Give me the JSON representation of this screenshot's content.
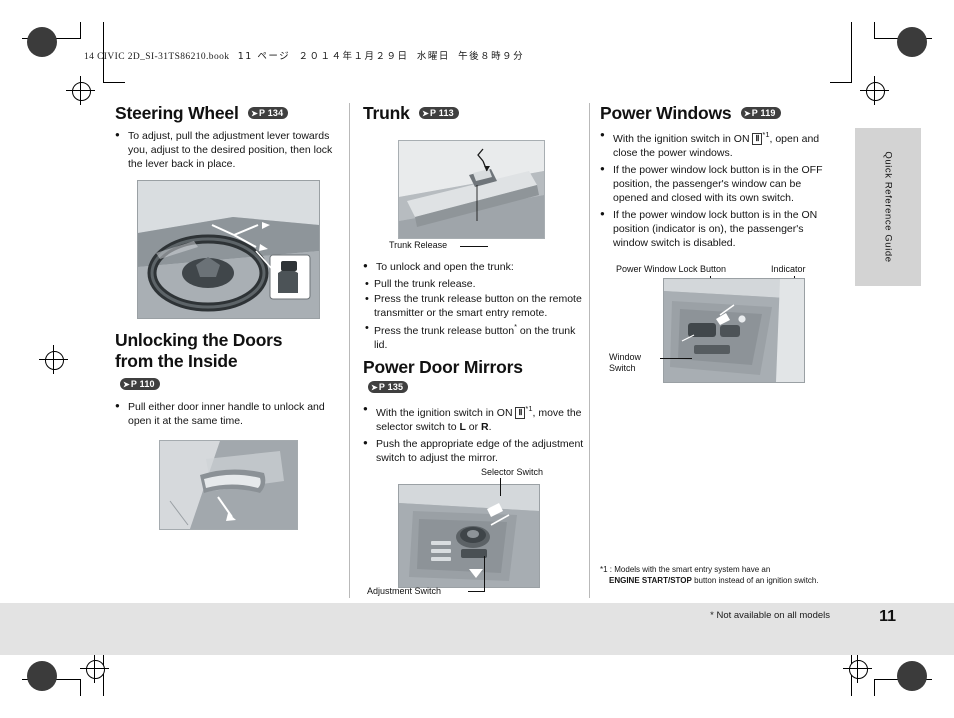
{
  "document": {
    "slug_code": "14 CIVIC 2D_SI-31TS86210.book",
    "slug_page": "11 ページ",
    "slug_date": "２０１４年１月２９日",
    "slug_day": "水曜日",
    "slug_time": "午後８時９分",
    "page_number": "11",
    "side_tab": "Quick Reference Guide",
    "bottom_note": "* Not available on all models"
  },
  "columns": {
    "left": {
      "section1": {
        "title": "Steering Wheel",
        "page_ref": "P 134",
        "bullets": [
          "To adjust, pull the adjustment lever towards you, adjust to the desired position, then lock the lever back in place."
        ]
      },
      "section2": {
        "title_line1": "Unlocking the Doors",
        "title_line2": "from the Inside",
        "page_ref": "P 110",
        "bullets": [
          "Pull either door inner handle to unlock and open it at the same time."
        ]
      }
    },
    "middle": {
      "section1": {
        "title": "Trunk",
        "page_ref": "P 113",
        "figure_label": "Trunk Release",
        "bullets": [
          "To unlock and open the trunk:"
        ],
        "sub_bullets": [
          "Pull the trunk release.",
          "Press the trunk release button on the remote transmitter or the smart entry remote.",
          "Press the trunk release button* on the trunk lid."
        ]
      },
      "section2": {
        "title": "Power Door Mirrors",
        "page_ref": "P 135",
        "bullets": [
          "With the ignition switch in ON Ⅱ*1, move the selector switch to L or R.",
          "Push the appropriate edge of the adjustment switch to adjust the mirror."
        ],
        "figure_labels": {
          "selector": "Selector Switch",
          "adjustment": "Adjustment Switch"
        }
      }
    },
    "right": {
      "section1": {
        "title": "Power Windows",
        "page_ref": "P 119",
        "bullets": [
          "With the ignition switch in ON Ⅱ*1, open and close the power windows.",
          "If the power window lock button is in the OFF position, the passenger's window can be opened and closed with its own switch.",
          "If the power window lock button is in the ON position (indicator is on), the passenger's window switch is disabled."
        ],
        "figure_labels": {
          "lock_button": "Power Window Lock Button",
          "indicator": "Indicator",
          "window_switch_line1": "Window",
          "window_switch_line2": "Switch"
        }
      },
      "footnote": {
        "marker": "*1 :",
        "text_before": "Models with the smart entry system have an",
        "bold": "ENGINE START/STOP",
        "text_after": "button instead of an ignition switch."
      }
    }
  },
  "colors": {
    "pill_bg": "#3f3f3f",
    "band_bg": "#e3e3e3",
    "tab_bg": "#d3d3d3"
  }
}
